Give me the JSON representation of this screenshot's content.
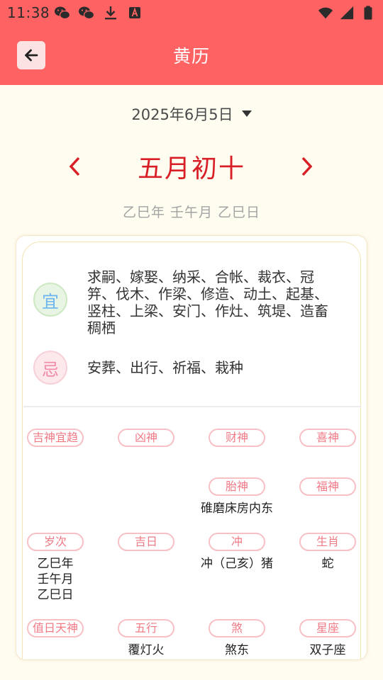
{
  "status_bar": {
    "time": "11:38",
    "left_icons": [
      "wechat-icon",
      "wechat-icon",
      "download-icon",
      "a-box-icon"
    ],
    "right_icons": [
      "wifi-icon",
      "cell-signal-icon",
      "battery-icon"
    ]
  },
  "app_bar": {
    "title": "黄历",
    "back_icon": "arrow-left-icon"
  },
  "date_selector": {
    "label": "2025年6月5日",
    "icon": "dropdown-caret-icon"
  },
  "lunar": {
    "label": "五月初十",
    "prev_icon": "chevron-left-icon",
    "next_icon": "chevron-right-icon"
  },
  "ganzhi": "乙巳年 壬午月 乙巳日",
  "yi": {
    "badge": "宜",
    "text": "求嗣、嫁娶、纳采、合帐、裁衣、冠笄、伐木、作梁、修造、动土、起基、竖柱、上梁、安门、作灶、筑堤、造畜稠栖"
  },
  "ji": {
    "badge": "忌",
    "text": "安葬、出行、祈福、栽种"
  },
  "grid": {
    "jishen_yiqu": {
      "label": "吉神宜趋",
      "value": ""
    },
    "xiongshen": {
      "label": "凶神",
      "value": ""
    },
    "caishen": {
      "label": "财神",
      "value": ""
    },
    "xishen": {
      "label": "喜神",
      "value": ""
    },
    "taishen": {
      "label": "胎神",
      "value": "碓磨床房内东"
    },
    "fushen": {
      "label": "福神",
      "value": ""
    },
    "suici": {
      "label": "岁次",
      "lines": [
        "乙巳年",
        "壬午月",
        "乙巳日"
      ]
    },
    "jiri": {
      "label": "吉日",
      "value": ""
    },
    "chong": {
      "label": "冲",
      "value": "冲（己亥）猪"
    },
    "shengxiao": {
      "label": "生肖",
      "value": "蛇"
    },
    "zhiri_tianshen": {
      "label": "值日天神",
      "value": ""
    },
    "wuxing": {
      "label": "五行",
      "value": "覆灯火"
    },
    "sha": {
      "label": "煞",
      "value": "煞东"
    },
    "xingzuo": {
      "label": "星座",
      "value": "双子座"
    }
  },
  "colors": {
    "primary": "#ff6262",
    "background": "#fffcf0",
    "lunar_red": "#d91f26",
    "tag_border": "#f7c0c5",
    "tag_text": "#f07a85"
  }
}
